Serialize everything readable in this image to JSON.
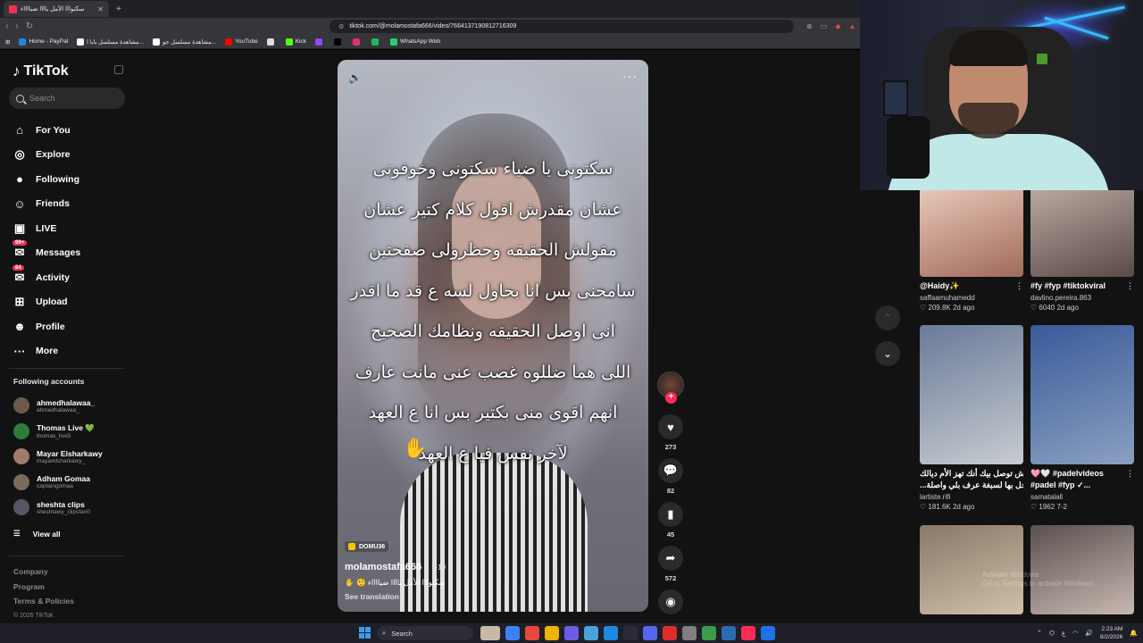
{
  "browser": {
    "tab_title": "سكتوااا الأمل ياااا ضيااااء",
    "new_tab": "+",
    "url": "tiktok.com/@molamostafa666/video/7664137190812716309",
    "bookmarks": [
      {
        "label": "Home - PayPal",
        "color": "#1e88e5"
      },
      {
        "label": "مشاهدة مسلسل بابا ا...",
        "color": "#ffffff"
      },
      {
        "label": "مشاهدة مسلسل جو...",
        "color": "#ffffff"
      },
      {
        "label": "YouTube",
        "color": "#ff0000"
      },
      {
        "label": "",
        "color": "#dddddd"
      },
      {
        "label": "Kick",
        "color": "#53fc18"
      },
      {
        "label": "",
        "color": "#9146ff"
      },
      {
        "label": "",
        "color": "#000000"
      },
      {
        "label": "",
        "color": "#e1306c"
      },
      {
        "label": "",
        "color": "#1db954"
      },
      {
        "label": "WhatsApp Web",
        "color": "#25d366"
      }
    ]
  },
  "sidebar": {
    "logo": "TikTok",
    "search_placeholder": "Search",
    "nav": [
      {
        "label": "For You",
        "icon": "home-icon",
        "glyph": "⌂"
      },
      {
        "label": "Explore",
        "icon": "compass-icon",
        "glyph": "◎"
      },
      {
        "label": "Following",
        "icon": "following-icon",
        "glyph": "●"
      },
      {
        "label": "Friends",
        "icon": "friends-icon",
        "glyph": "☺"
      },
      {
        "label": "LIVE",
        "icon": "live-icon",
        "glyph": "▣"
      },
      {
        "label": "Messages",
        "icon": "messages-icon",
        "glyph": "✉",
        "badge": "99+"
      },
      {
        "label": "Activity",
        "icon": "activity-icon",
        "glyph": "✉",
        "badge": "84"
      },
      {
        "label": "Upload",
        "icon": "upload-icon",
        "glyph": "⊞"
      },
      {
        "label": "Profile",
        "icon": "profile-icon",
        "glyph": "☻"
      },
      {
        "label": "More",
        "icon": "more-icon",
        "glyph": "···"
      }
    ],
    "following_header": "Following accounts",
    "following": [
      {
        "name": "ahmedhalawaa_",
        "handle": "ahmedhalawaa_",
        "color": "#6b5a4a"
      },
      {
        "name": "Thomas Live 💚",
        "handle": "thomas_live5",
        "color": "#2f7a3c"
      },
      {
        "name": "Mayar Elsharkawy",
        "handle": "mayarelsharkawy_",
        "color": "#a07a6a"
      },
      {
        "name": "Adham Gomaa",
        "handle": "captaingomaa",
        "color": "#7a6a5a"
      },
      {
        "name": "sheshta clips",
        "handle": "sheshtawy_clipsfan0",
        "color": "#555566"
      }
    ],
    "view_all": "View all",
    "footer": [
      "Company",
      "Program",
      "Terms & Policies"
    ],
    "copyright": "© 2026 TikTok"
  },
  "video": {
    "caption_lines": [
      "سكتونى يا ضياء سكتونى وخوفونى",
      "عشان مقدرش اقول كلام كتير عشان",
      "مقولش الحقيقه وحظرولى صفحتين",
      "سامحنى بس انا بحاول لسه ع قد ما اقدر",
      "انى اوصل الحقيقه ونظامك الصحيح",
      "اللى هما ضللوه غصب عنى مانت عارف",
      "انهم اقوى منى بكتير بس انا ع العهد",
      "لآخر نفس فيا ع العهد"
    ],
    "hand_emoji": "✋",
    "tag": "DOMU36",
    "author": "molamostafa666",
    "date": "· 7-19",
    "description": "سكتوااا الأمل ياااا ضيااااء 🤨 ✋",
    "see_translation": "See translation"
  },
  "actions": {
    "likes": "273",
    "comments": "82",
    "saves": "45",
    "shares": "572"
  },
  "grid": [
    {
      "title": "@Haidy✨",
      "user": "saffaamuhamedd",
      "views": "♡ 209.8K",
      "age": "2d ago",
      "thumb": [
        "#e8c8b8",
        "#a06a5a"
      ]
    },
    {
      "title": "#fy #fyp #tiktokviral",
      "user": "davlino.pereira.863",
      "views": "♡ 6040",
      "age": "2d ago",
      "thumb": [
        "#b8a8a0",
        "#5a4a48"
      ]
    },
    {
      "title": "بش توصل بيك أنك تهز الأم ديالك",
      "title2": "...دخل بها لسبغة عرف بلي واصلة",
      "user": "lartiste.rifi",
      "views": "♡ 181.6K",
      "age": "2d ago",
      "thumb": [
        "#6a7a9a",
        "#c8ccd0"
      ]
    },
    {
      "title": "🩷🤍 #padelvideos",
      "title2": "#padel #fyp ✓...",
      "user": "samatalall",
      "views": "♡ 1962",
      "age": "7-2",
      "thumb": [
        "#3a5a9a",
        "#8aa0c0"
      ]
    },
    {
      "title": "",
      "user": "",
      "views": "",
      "age": "",
      "thumb": [
        "#8a7868",
        "#d0c0a8"
      ]
    },
    {
      "title": "",
      "user": "",
      "views": "",
      "age": "",
      "thumb": [
        "#5a5050",
        "#c8b8b0"
      ]
    }
  ],
  "watermark": "Activate Windows\nGo to Settings to activate Windows.",
  "taskbar": {
    "search": "Search",
    "time": "2:23 AM",
    "date": "8/2/2026",
    "lang": "ع"
  }
}
